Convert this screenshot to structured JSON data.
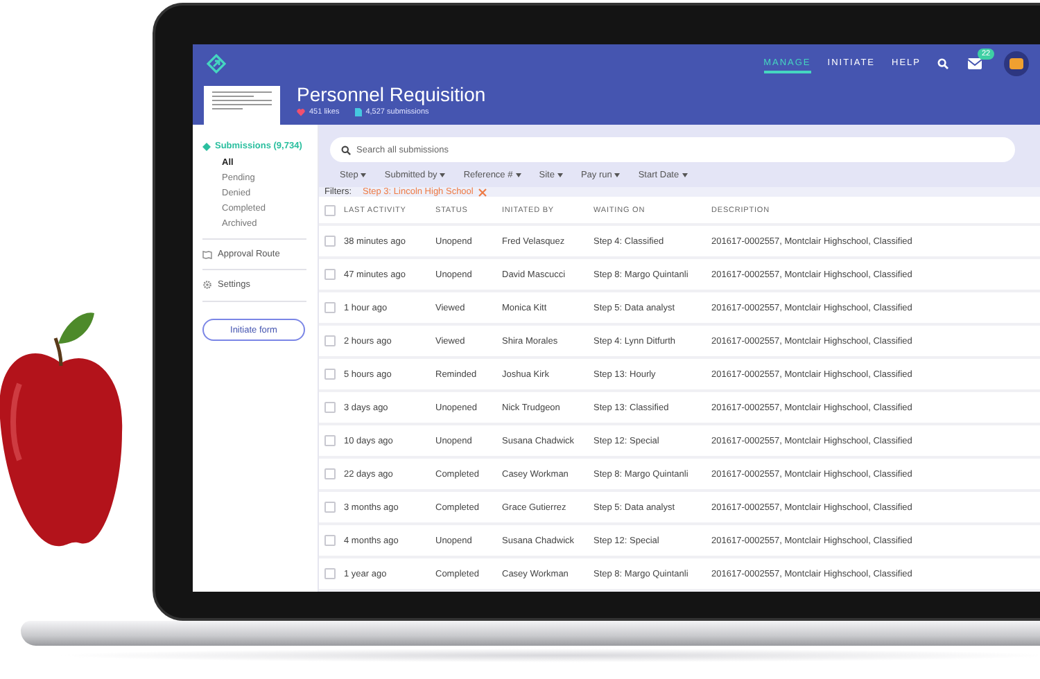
{
  "header": {
    "nav": [
      {
        "label": "MANAGE",
        "selected": true
      },
      {
        "label": "INITIATE",
        "selected": false
      },
      {
        "label": "HELP",
        "selected": false
      }
    ],
    "mail_badge": "22",
    "form": {
      "title": "Personnel Requisition",
      "likes": "451 likes",
      "submissions": "4,527 submissions"
    }
  },
  "sidebar": {
    "section": "Submissions (9,734)",
    "items": [
      {
        "label": "All",
        "selected": true
      },
      {
        "label": "Pending",
        "selected": false
      },
      {
        "label": "Denied",
        "selected": false
      },
      {
        "label": "Completed",
        "selected": false
      },
      {
        "label": "Archived",
        "selected": false
      }
    ],
    "links": [
      {
        "label": "Approval Route",
        "kind": "route"
      },
      {
        "label": "Settings",
        "kind": "settings"
      }
    ],
    "button": "Initiate form"
  },
  "search": {
    "placeholder": "Search all submissions"
  },
  "filter_dropdowns": [
    "Step",
    "Submitted by",
    "Reference #",
    "Site",
    "Pay run",
    "Start Date"
  ],
  "filters": {
    "label": "Filters:",
    "chips": [
      "Step 3: Lincoln High School"
    ]
  },
  "table": {
    "header_checked": false,
    "columns": [
      "LAST ACTIVITY",
      "STATUS",
      "INITATED BY",
      "WAITING ON",
      "DESCRIPTION"
    ],
    "rows": [
      {
        "checked": false,
        "cells": [
          "38 minutes ago",
          "Unopend",
          "Fred Velasquez",
          "Step 4: Classified",
          "201617-0002557, Montclair Highschool, Classified"
        ]
      },
      {
        "checked": false,
        "cells": [
          "47 minutes ago",
          "Unopend",
          "David Mascucci",
          "Step 8: Margo Quintanli",
          "201617-0002557, Montclair Highschool, Classified"
        ]
      },
      {
        "checked": false,
        "cells": [
          "1 hour ago",
          "Viewed",
          "Monica Kitt",
          "Step 5: Data analyst",
          "201617-0002557, Montclair Highschool, Classified"
        ]
      },
      {
        "checked": false,
        "cells": [
          "2 hours ago",
          "Viewed",
          "Shira Morales",
          "Step 4: Lynn Ditfurth",
          "201617-0002557, Montclair Highschool, Classified"
        ]
      },
      {
        "checked": false,
        "cells": [
          "5 hours ago",
          "Reminded",
          "Joshua Kirk",
          "Step 13: Hourly",
          "201617-0002557, Montclair Highschool, Classified"
        ]
      },
      {
        "checked": false,
        "cells": [
          "3 days ago",
          "Unopened",
          "Nick Trudgeon",
          "Step 13: Classified",
          "201617-0002557, Montclair Highschool, Classified"
        ]
      },
      {
        "checked": false,
        "cells": [
          "10 days ago",
          "Unopend",
          "Susana Chadwick",
          "Step 12: Special",
          "201617-0002557, Montclair Highschool, Classified"
        ]
      },
      {
        "checked": false,
        "cells": [
          "22 days ago",
          "Completed",
          "Casey Workman",
          "Step 8: Margo Quintanli",
          "201617-0002557, Montclair Highschool, Classified"
        ]
      },
      {
        "checked": false,
        "cells": [
          "3 months ago",
          "Completed",
          "Grace Gutierrez",
          "Step 5: Data analyst",
          "201617-0002557, Montclair Highschool, Classified"
        ]
      },
      {
        "checked": false,
        "cells": [
          "4 months ago",
          "Unopend",
          "Susana Chadwick",
          "Step 12: Special",
          "201617-0002557, Montclair Highschool, Classified"
        ]
      },
      {
        "checked": false,
        "cells": [
          "1 year ago",
          "Completed",
          "Casey Workman",
          "Step 8: Margo Quintanli",
          "201617-0002557, Montclair Highschool, Classified"
        ]
      }
    ]
  }
}
